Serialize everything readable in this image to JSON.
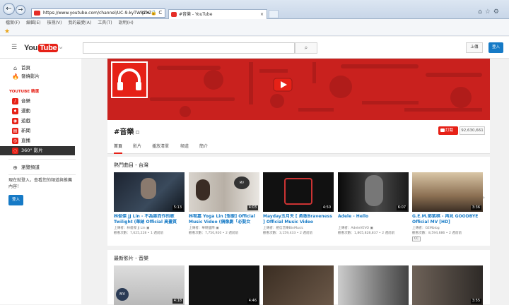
{
  "browser": {
    "url": "https://www.youtube.com/channel/UC-9-kyTW8ZkZ",
    "tab_title": "#音樂 - YouTube",
    "tab_close": "×",
    "menu": [
      "檔案(F)",
      "編輯(E)",
      "檢視(V)",
      "我的最愛(A)",
      "工具(T)",
      "說明(H)"
    ],
    "addr_tools": "ρ ▾ 🔒 C"
  },
  "header": {
    "logo_you": "You",
    "logo_tube": "Tube",
    "logo_region": "TW",
    "search_icon": "⌕",
    "upload_label": "上傳",
    "login_label": "登入"
  },
  "sidebar": {
    "items": [
      {
        "label": "首頁",
        "icon": "home-icon"
      },
      {
        "label": "發燒影片",
        "icon": "trending-icon"
      }
    ],
    "section_title": "YOUTUBE 精選",
    "channels": [
      {
        "label": "音樂"
      },
      {
        "label": "運動"
      },
      {
        "label": "遊戲"
      },
      {
        "label": "新聞"
      },
      {
        "label": "直播"
      },
      {
        "label": "360° 影片"
      }
    ],
    "browse": "瀏覽頻道",
    "signin_msg": "現在就登入，查看您的頻道與推薦內容！",
    "signin_button": "登入"
  },
  "channel": {
    "title": "#音樂",
    "subscribe": "訂閱",
    "subscribers": "92,630,661",
    "tabs": [
      "首頁",
      "影片",
      "播放清單",
      "頻道",
      "簡介"
    ],
    "shelves": [
      {
        "title": "熱門曲目 - 台灣",
        "videos": [
          {
            "title": "林俊傑 JJ Lin - 不為誰而作的歌 Twilight (華納 Official 高畫質 HI...",
            "uploader": "上傳者：林俊傑 JJ Lin ▣",
            "meta": "觀看次數：7,625,228 • 1 週前前",
            "duration": "5:13"
          },
          {
            "title": "林宥嘉 Yoga Lin [想要] Official Music Video (偶像劇「必娶女人」...",
            "uploader": "上傳者：華研國際 ▣",
            "meta": "觀看次數：7,750,920 • 2 週前前",
            "duration": "4:03"
          },
          {
            "title": "Mayday五月天 [ 勇敢Braveness ] Official Music Video",
            "uploader": "上傳者：相信音樂BinMusic",
            "meta": "觀看次數：3,159,433 • 2 週前前",
            "duration": "4:50"
          },
          {
            "title": "Adele - Hello",
            "uploader": "上傳者：AdeleVEVO ▣",
            "meta": "觀看次數：1,805,828,837 • 2 週前前",
            "duration": "6:07"
          },
          {
            "title": "G.E.M.鄧紫棋 - 再見 GOODBYE Official MV [HD]",
            "uploader": "上傳者：GEMblog",
            "meta": "觀看次數：8,594,686 • 2 週前前",
            "duration": "3:36",
            "cc": "CC"
          }
        ]
      },
      {
        "title": "最新影片 - 音樂",
        "videos": [
          {
            "title": "",
            "duration": "4:18"
          },
          {
            "title": "",
            "duration": "4:46"
          },
          {
            "title": "",
            "duration": ""
          },
          {
            "title": "",
            "duration": ""
          },
          {
            "title": "",
            "duration": "3:55"
          }
        ]
      }
    ]
  },
  "colors": {
    "brand_red": "#e62117",
    "link_blue": "#167ac6"
  }
}
